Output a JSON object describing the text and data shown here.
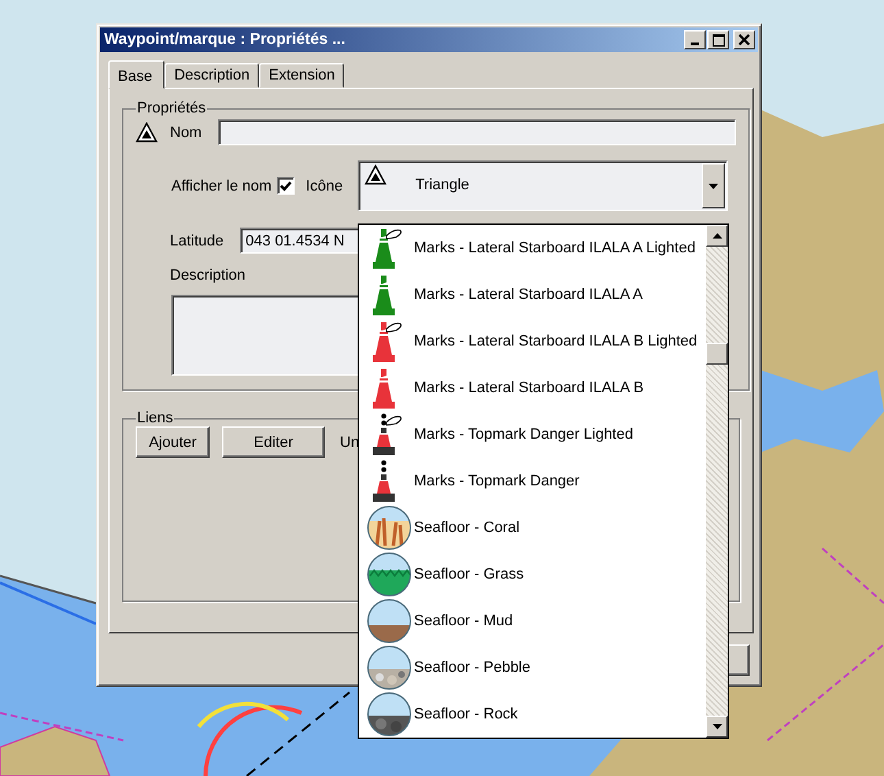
{
  "window": {
    "title": "Waypoint/marque : Propriétés ..."
  },
  "tabs": [
    {
      "label": "Base",
      "selected": true
    },
    {
      "label": "Description",
      "selected": false
    },
    {
      "label": "Extension",
      "selected": false
    }
  ],
  "properties": {
    "legend": "Propriétés",
    "name_label": "Nom",
    "show_name": {
      "label": "Afficher le nom",
      "checked": true
    },
    "icon_label": "Icône",
    "icon_value": "Triangle",
    "latitude_label": "Latitude",
    "latitude_value": "043 01.4534 N",
    "description_label": "Description"
  },
  "links": {
    "legend": "Liens",
    "buttons": [
      "Ajouter",
      "Editer"
    ],
    "note": "Un"
  },
  "icon_list": [
    {
      "label": "Marks - Lateral Starboard ILALA A Lighted",
      "kind": "buoy",
      "color": "#1a8c1a",
      "lighted": true
    },
    {
      "label": "Marks - Lateral Starboard ILALA A",
      "kind": "buoy",
      "color": "#1a8c1a",
      "lighted": false
    },
    {
      "label": "Marks - Lateral Starboard ILALA B Lighted",
      "kind": "buoy",
      "color": "#e8333a",
      "lighted": true
    },
    {
      "label": "Marks - Lateral Starboard ILALA B",
      "kind": "buoy",
      "color": "#e8333a",
      "lighted": false
    },
    {
      "label": "Marks - Topmark Danger Lighted",
      "kind": "topmark",
      "lighted": true
    },
    {
      "label": "Marks - Topmark Danger",
      "kind": "topmark",
      "lighted": false
    },
    {
      "label": "Seafloor - Coral",
      "kind": "coral"
    },
    {
      "label": "Seafloor - Grass",
      "kind": "grass"
    },
    {
      "label": "Seafloor - Mud",
      "kind": "mud"
    },
    {
      "label": "Seafloor - Pebble",
      "kind": "pebble"
    },
    {
      "label": "Seafloor - Rock",
      "kind": "rock"
    }
  ]
}
